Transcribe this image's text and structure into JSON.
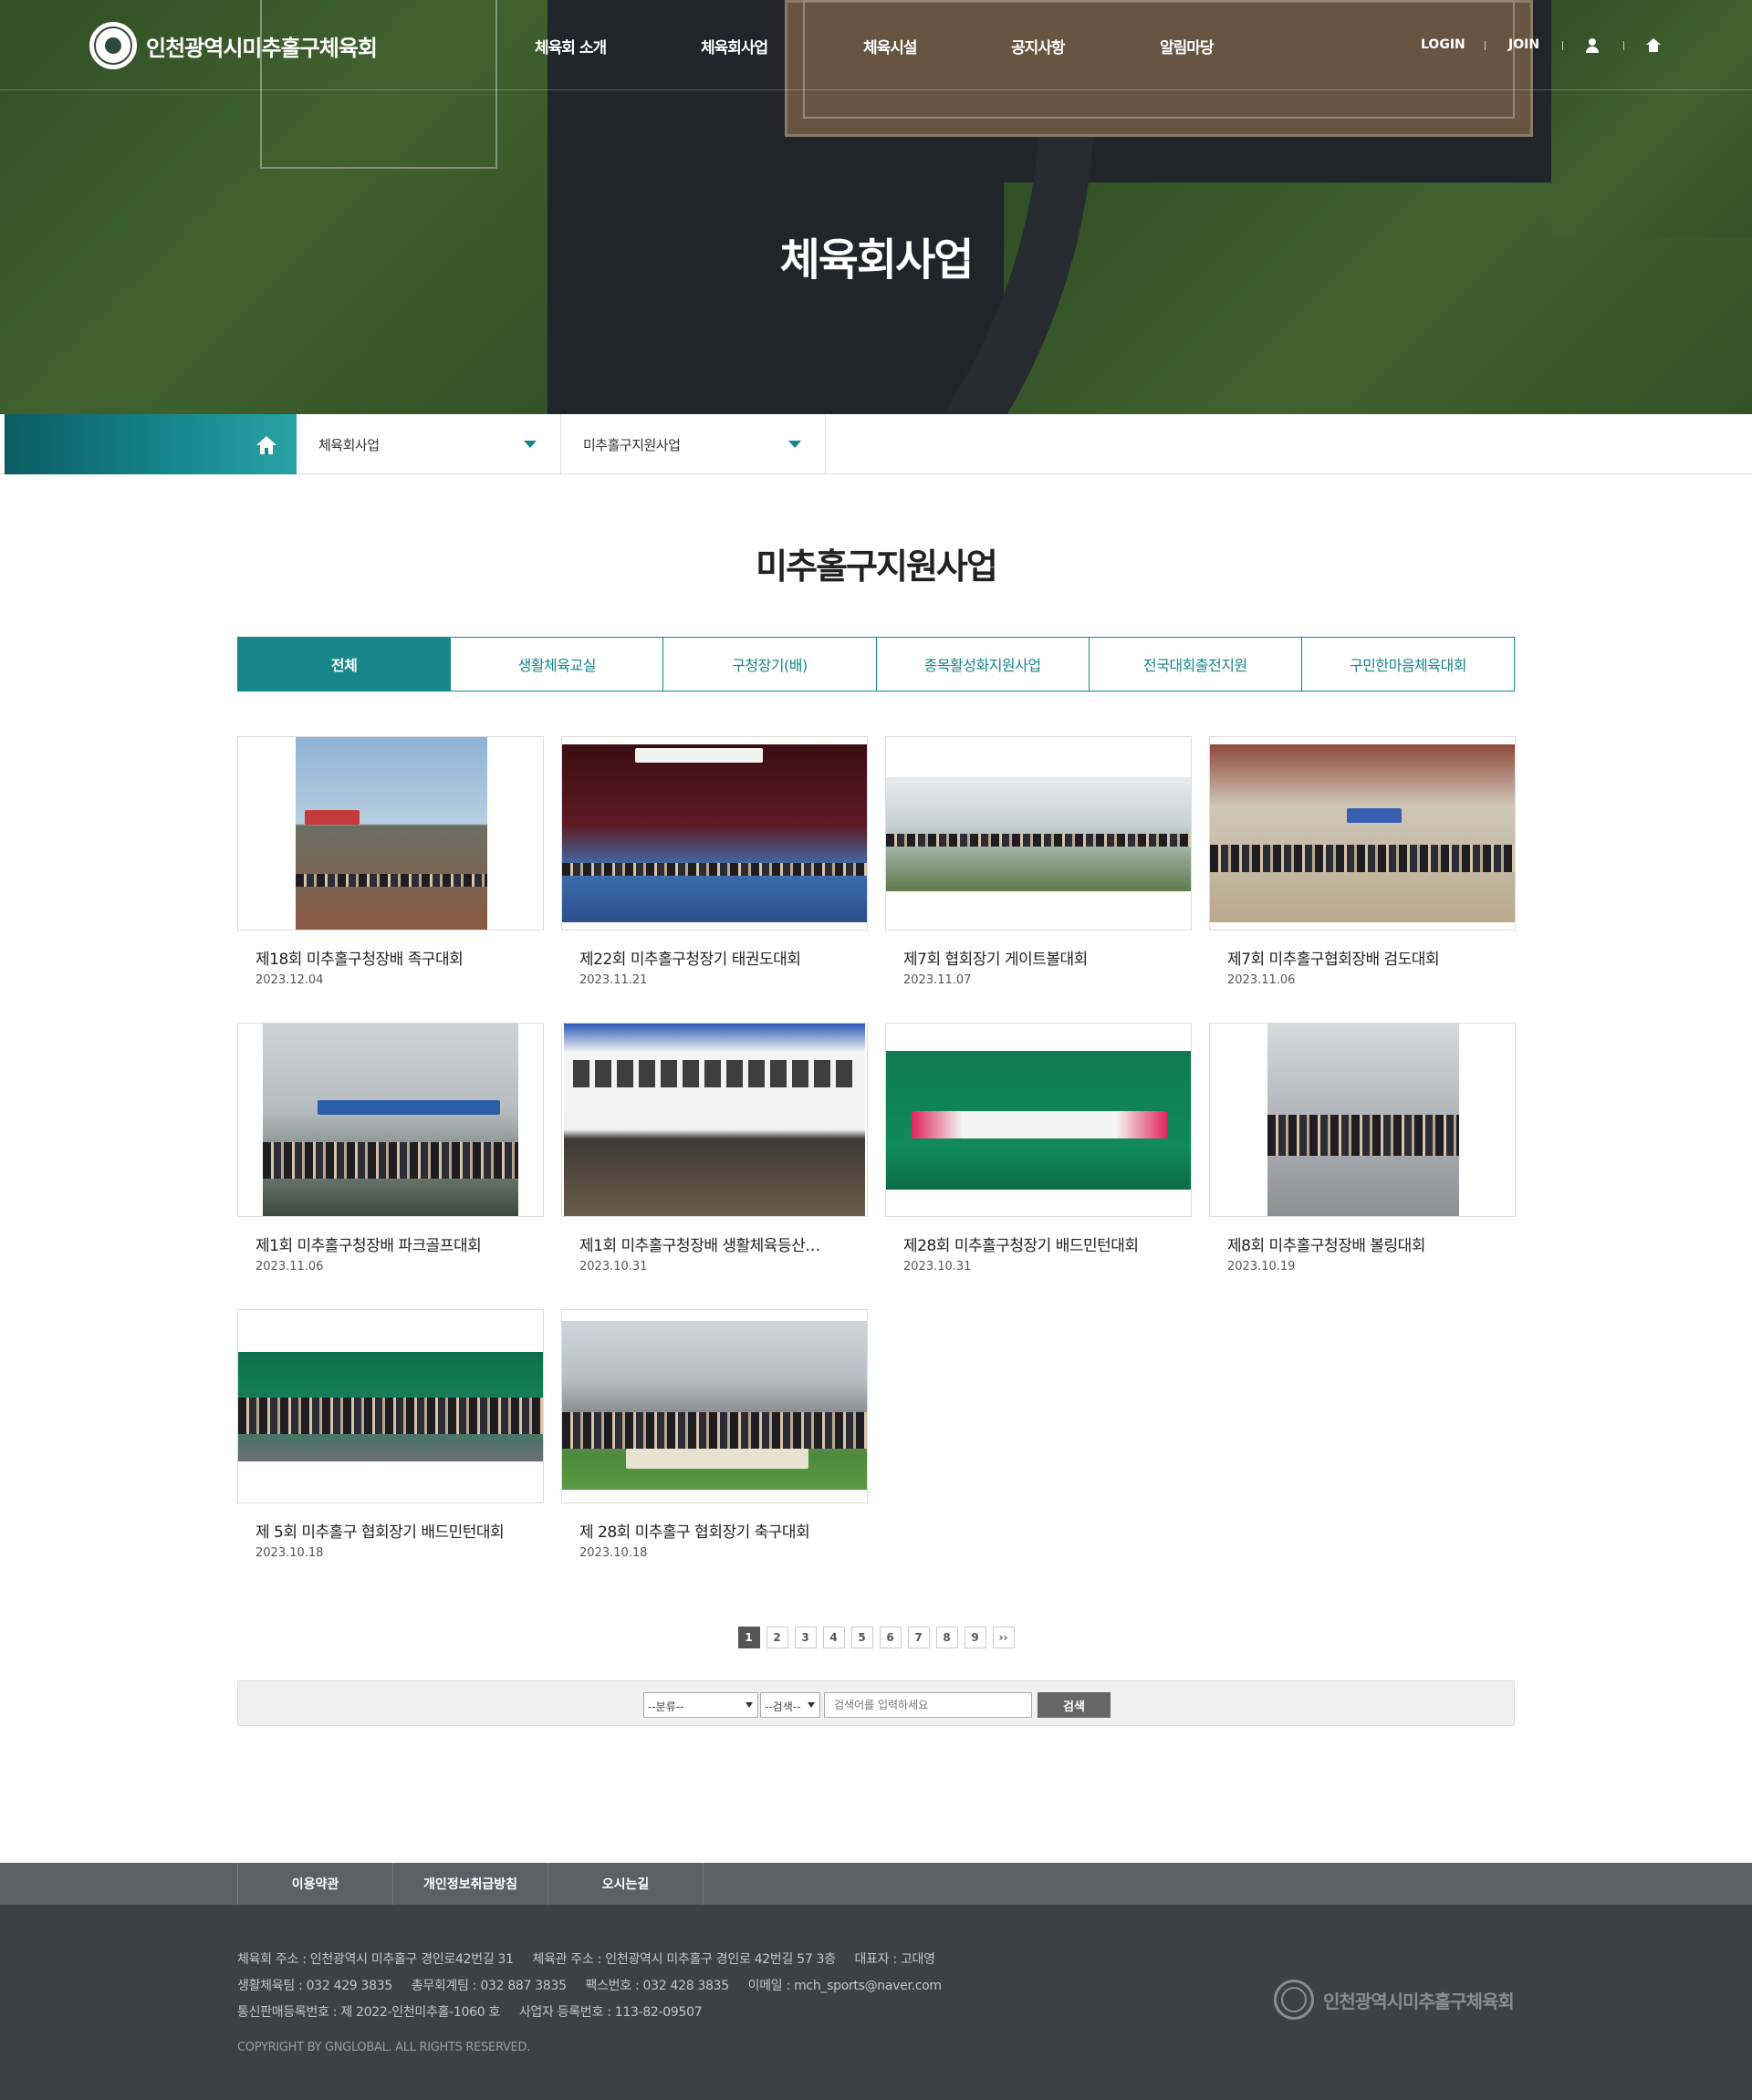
{
  "header": {
    "site_name": "인천광역시미추홀구체육회",
    "nav": [
      "체육회 소개",
      "체육회사업",
      "체육시설",
      "공지사항",
      "알림마당"
    ],
    "util": {
      "login": "LOGIN",
      "join": "JOIN"
    },
    "hero_title": "체육회사업"
  },
  "location": {
    "level1": "체육회사업",
    "level2": "미추홀구지원사업"
  },
  "page_title": "미추홀구지원사업",
  "tabs": [
    "전체",
    "생활체육교실",
    "구청장기(배)",
    "종목활성화지원사업",
    "전국대회출전지원",
    "구민한마음체육대회"
  ],
  "active_tab": "전체",
  "posts": [
    {
      "title": "제18회 미추홀구청장배 족구대회",
      "date": "2023.12.04"
    },
    {
      "title": "제22회 미추홀구청장기 태권도대회",
      "date": "2023.11.21"
    },
    {
      "title": "제7회 협회장기 게이트볼대회",
      "date": "2023.11.07"
    },
    {
      "title": "제7회 미추홀구협회장배 검도대회",
      "date": "2023.11.06"
    },
    {
      "title": "제1회 미추홀구청장배 파크골프대회",
      "date": "2023.11.06"
    },
    {
      "title": "제1회 미추홀구청장배 생활체육등산…",
      "date": "2023.10.31"
    },
    {
      "title": "제28회 미추홀구청장기 배드민턴대회",
      "date": "2023.10.31"
    },
    {
      "title": "제8회 미추홀구청장배 볼링대회",
      "date": "2023.10.19"
    },
    {
      "title": "제 5회 미추홀구 협회장기 배드민턴대회",
      "date": "2023.10.18"
    },
    {
      "title": "제 28회 미추홀구 협회장기 축구대회",
      "date": "2023.10.18"
    }
  ],
  "pagination": {
    "pages": [
      "1",
      "2",
      "3",
      "4",
      "5",
      "6",
      "7",
      "8",
      "9"
    ],
    "current": "1",
    "next": "››"
  },
  "search": {
    "category": "--분류--",
    "field": "--검색--",
    "placeholder": "검색어를 입력하세요",
    "button": "검색"
  },
  "footer": {
    "links": [
      "이용약관",
      "개인정보취급방침",
      "오시는길"
    ],
    "line1": "체육회 주소 : 인천광역시 미추홀구 경인로42번길 31     체육관 주소 : 인천광역시 미추홀구 경인로 42번길 57 3층     대표자 : 고대영",
    "line2": "생활체육팀 : 032 429 3835     총무회계팀 : 032 887 3835     팩스번호 : 032 428 3835     이메일 : mch_sports@naver.com",
    "line3": "통신판매등록번호 : 제 2022-인천미추홀-1060 호     사업자 등록번호 : 113-82-09507",
    "copyright": "COPYRIGHT BY GNGLOBAL. ALL RIGHTS RESERVED.",
    "logo_text": "인천광역시미추홀구체육회"
  },
  "colors": {
    "accent": "#17868a",
    "footer_bg": "#3d4047",
    "footer_nav_bg": "#5c5f66"
  }
}
